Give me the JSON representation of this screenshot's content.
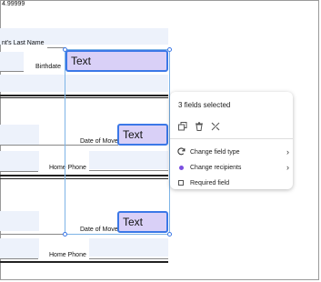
{
  "doc": {
    "top_partial": "4.99999",
    "last_name_label": "nt's Last Name",
    "birthdate_label": "Birthdate",
    "date_of_move_label_1": "Date of Move",
    "home_phone_label_1": "Home Phone",
    "date_of_move_label_2": "Date of Move",
    "home_phone_label_2": "Home Phone"
  },
  "fields": [
    {
      "text": "Text"
    },
    {
      "text": "Text"
    },
    {
      "text": "Text"
    }
  ],
  "panel": {
    "title": "3 fields selected",
    "tools": [
      {
        "name": "duplicate-icon",
        "glyph": "⧉"
      },
      {
        "name": "trash-icon",
        "glyph": "🗑"
      },
      {
        "name": "unlink-icon",
        "glyph": "⤫"
      }
    ],
    "menu": [
      {
        "label": "Change field type",
        "icon": "refresh-icon",
        "has_submenu": true
      },
      {
        "label": "Change recipients",
        "icon": "recipient-dot-icon",
        "has_submenu": true
      },
      {
        "label": "Required field",
        "icon": "checkbox-icon",
        "has_submenu": false
      }
    ],
    "chevron": "›"
  },
  "colors": {
    "selection": "#3b78e7",
    "field_fill": "#d9d0f7",
    "recipient": "#7b4fe0"
  }
}
